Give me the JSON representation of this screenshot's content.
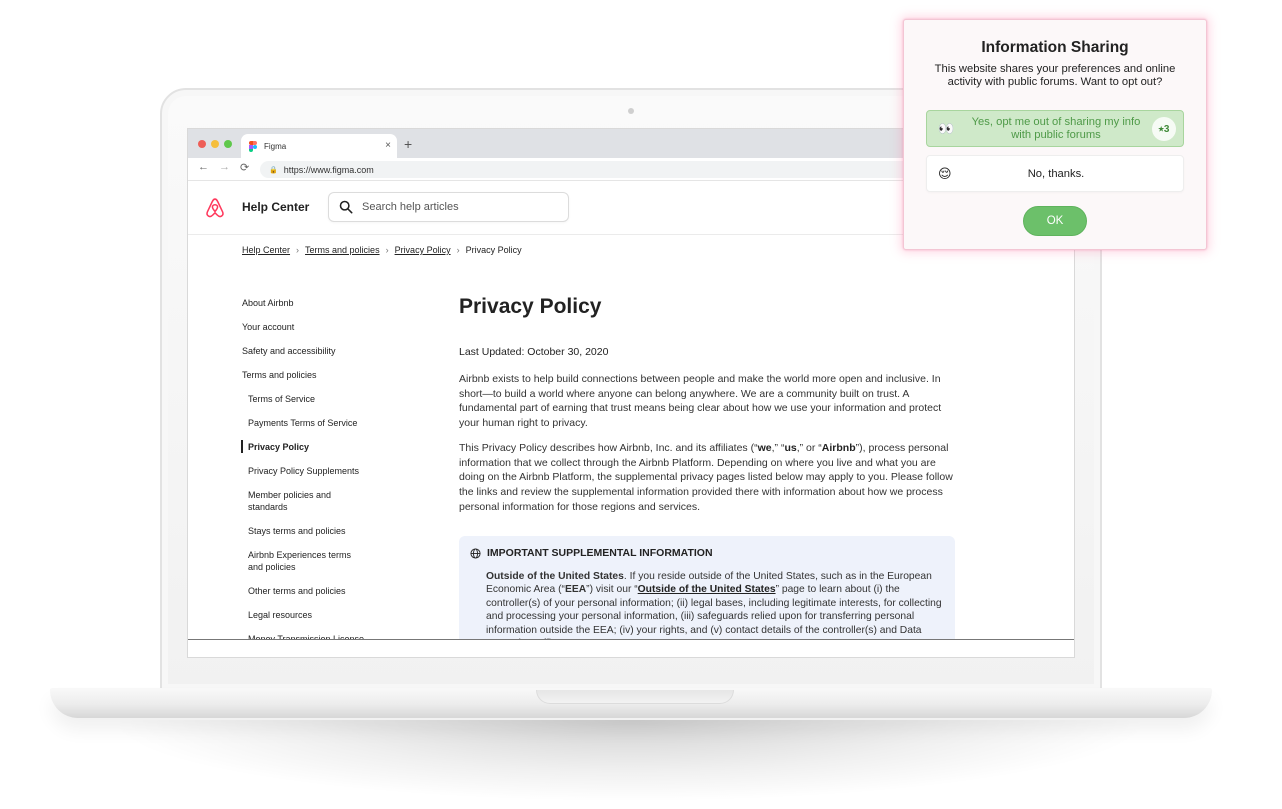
{
  "browser": {
    "tab_title": "Figma",
    "tab_close": "×",
    "new_tab": "+",
    "url": "https://www.figma.com",
    "back_glyph": "←",
    "forward_glyph": "→",
    "reload_glyph": "⟳"
  },
  "header": {
    "title": "Help Center",
    "search_placeholder": "Search help articles",
    "brand_color": "#ff385c"
  },
  "breadcrumb": [
    "Help Center",
    "Terms and policies",
    "Privacy Policy",
    "Privacy Policy"
  ],
  "sidebar": {
    "items": [
      {
        "label": "About Airbnb"
      },
      {
        "label": "Your account"
      },
      {
        "label": "Safety and accessibility"
      },
      {
        "label": "Terms and policies"
      },
      {
        "label": "Terms of Service"
      },
      {
        "label": "Payments Terms of Service"
      },
      {
        "label": "Privacy Policy"
      },
      {
        "label": "Privacy Policy Supplements"
      },
      {
        "label": "Member policies and standards"
      },
      {
        "label": "Stays terms and policies"
      },
      {
        "label": "Airbnb Experiences terms and policies"
      },
      {
        "label": "Other terms and policies"
      },
      {
        "label": "Legal resources"
      },
      {
        "label": "Money Transmission License"
      }
    ]
  },
  "article": {
    "title": "Privacy Policy",
    "updated": "Last Updated: October 30, 2020",
    "p1": "Airbnb exists to help build connections between people and make the world more open and inclusive. In short—to build a world where anyone can belong anywhere. We are a community built on trust. A fundamental part of earning that trust means being clear about how we use your information and protect your human right to privacy.",
    "p2_a": "This Privacy Policy describes how Airbnb, Inc. and its affiliates (“",
    "p2_we": "we",
    "p2_b": ",” “",
    "p2_us": "us",
    "p2_c": ",” or “",
    "p2_airbnb": "Airbnb",
    "p2_d": "”), process personal information that we collect through the Airbnb Platform. Depending on where you live and what you are doing on the Airbnb Platform, the supplemental privacy pages listed below may apply to you. Please follow the links and review the supplemental information provided there with information about how we process personal information for those regions and services.",
    "info_heading": "IMPORTANT SUPPLEMENTAL INFORMATION",
    "info_lead": "Outside of the United States",
    "info_a": ". If you reside outside of the United States, such as in the European Economic Area (“",
    "info_eea": "EEA",
    "info_b": "”) visit our “",
    "info_link": "Outside of the United States",
    "info_c": "” page to learn about (i) the controller(s) of your personal information; (ii) legal bases, including legitimate interests, for collecting and processing your personal information, (iii) safeguards relied upon for transferring personal information outside the EEA; (iv) your rights, and (v) contact details of the controller(s) and Data Protection Officer."
  },
  "dialog": {
    "title": "Information Sharing",
    "text": "This website shares your preferences and online activity with public forums. Want to opt out?",
    "yes_emoji": "👀",
    "yes_label": "Yes, opt me out of sharing my info with public forums",
    "yes_badge": "⭑3",
    "no_emoji": "😌",
    "no_label": "No, thanks.",
    "ok_label": "OK",
    "accent": "#6cc06a"
  }
}
